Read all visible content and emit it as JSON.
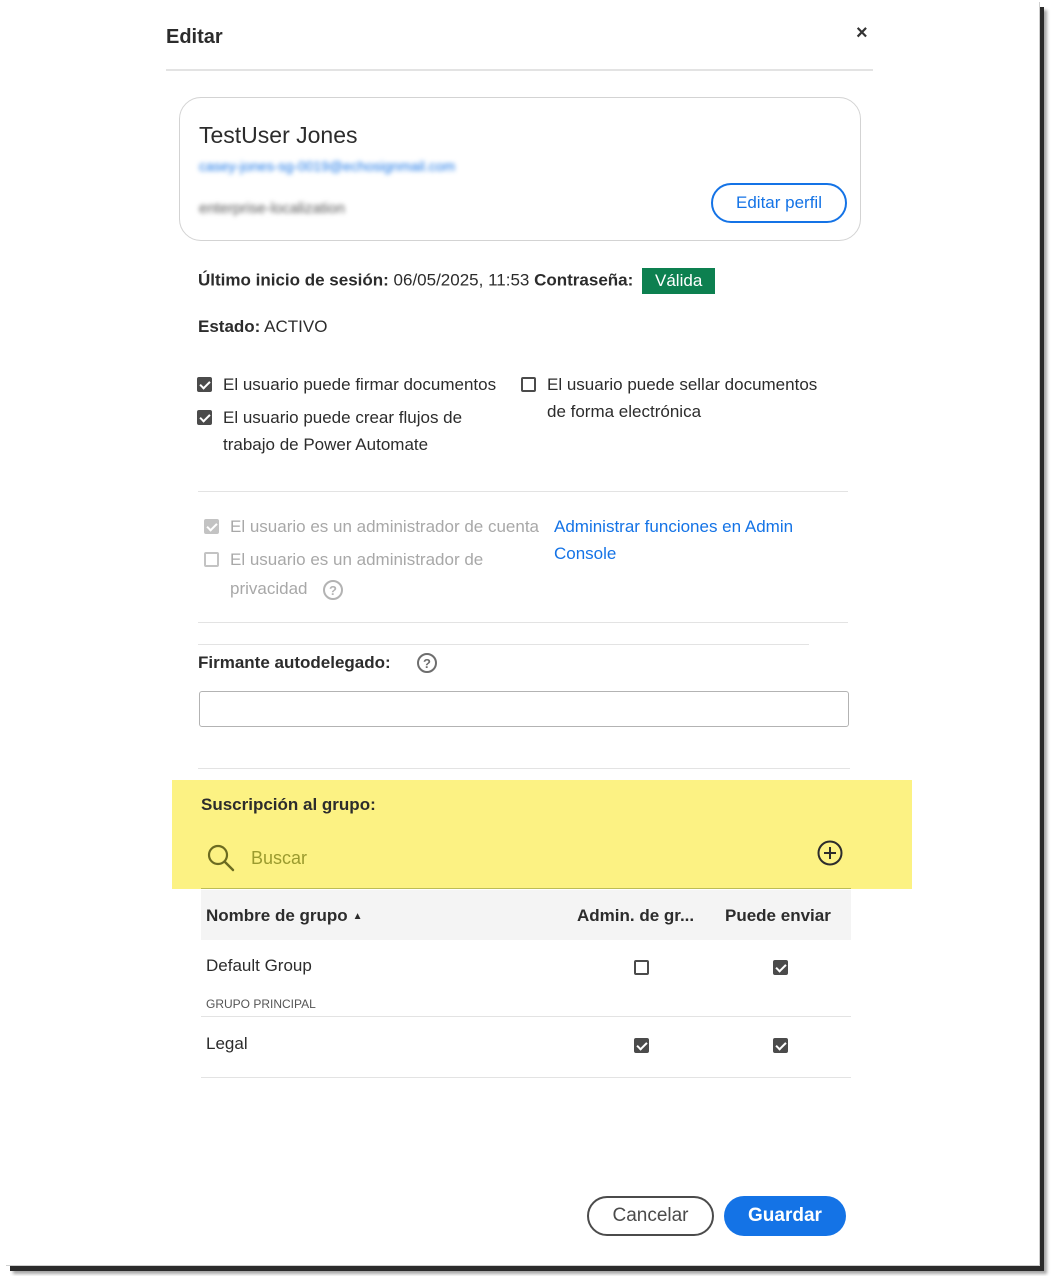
{
  "dialog": {
    "title": "Editar",
    "close_label": "×"
  },
  "profile": {
    "name": "TestUser Jones",
    "email": "casey-jones-sg-0019@echosignmail.com",
    "organization": "enterprise-localization",
    "edit_button": "Editar perfil"
  },
  "status": {
    "last_login_label": "Último inicio de sesión:",
    "last_login_value": "06/05/2025, 11:53",
    "password_label": "Contraseña:",
    "password_value": "Válida",
    "state_label": "Estado:",
    "state_value": "ACTIVO"
  },
  "permissions": {
    "sign_docs": {
      "label": "El usuario puede firmar documentos",
      "checked": true
    },
    "power_automate": {
      "label_line1": "El usuario puede crear flujos de",
      "label_line2": "trabajo de Power Automate",
      "checked": true
    },
    "seal_docs": {
      "label_line1": "El usuario puede sellar documentos",
      "label_line2": "de forma electrónica",
      "checked": false
    }
  },
  "admin": {
    "account_admin": {
      "label": "El usuario es un administrador de cuenta",
      "checked": true
    },
    "privacy_admin": {
      "label_line1": "El usuario es un administrador de",
      "label_line2": "privacidad",
      "checked": false
    },
    "manage_link_line1": "Administrar funciones en Admin",
    "manage_link_line2": "Console",
    "help_glyph": "?"
  },
  "self_delegated": {
    "label": "Firmante autodelegado:",
    "value": "",
    "help_glyph": "?"
  },
  "groups": {
    "title": "Suscripción al grupo:",
    "search_placeholder": "Buscar",
    "columns": {
      "name": "Nombre de grupo",
      "sort_glyph": "▲",
      "admin": "Admin. de gr...",
      "can_send": "Puede enviar"
    },
    "rows": [
      {
        "name": "Default Group",
        "subtitle": "GRUPO PRINCIPAL",
        "admin": false,
        "can_send": true
      },
      {
        "name": "Legal",
        "subtitle": "",
        "admin": true,
        "can_send": true
      }
    ]
  },
  "footer": {
    "cancel": "Cancelar",
    "save": "Guardar"
  },
  "colors": {
    "accent": "#1473e6",
    "valid_badge": "#0d8050",
    "highlight": "#fcf283",
    "search_text": "#9b9b2e"
  },
  "icons": {
    "close": "close-icon",
    "search": "search-icon",
    "add": "add-circle-icon",
    "help": "help-icon",
    "sort": "sort-ascending-icon"
  }
}
